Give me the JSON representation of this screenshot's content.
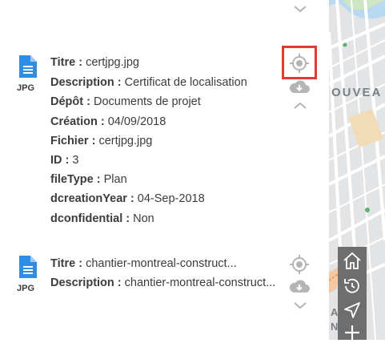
{
  "documents": [
    {
      "ext": "JPG",
      "fields": [
        {
          "key": "Titre :",
          "value": "certjpg.jpg"
        },
        {
          "key": "Description :",
          "value": "Certificat de localisation"
        },
        {
          "key": "Dépôt :",
          "value": "Documents de projet"
        },
        {
          "key": "Création :",
          "value": "04/09/2018"
        },
        {
          "key": "Fichier :",
          "value": "certjpg.jpg"
        },
        {
          "key": "ID :",
          "value": "3"
        },
        {
          "key": "fileType :",
          "value": "Plan"
        },
        {
          "key": "dcreationYear :",
          "value": "04-Sep-2018"
        },
        {
          "key": "dconfidential :",
          "value": "Non"
        }
      ]
    },
    {
      "ext": "JPG",
      "fields": [
        {
          "key": "Titre :",
          "value": "chantier-montreal-construct..."
        },
        {
          "key": "Description :",
          "value": "chantier-montreal-construct..."
        }
      ]
    }
  ],
  "map": {
    "street_label": "OUVEA",
    "partial_label_1": "A",
    "partial_label_2": "N"
  },
  "colors": {
    "doc_icon": "#2e8ee6",
    "highlight": "#e53b2c",
    "action_icon": "#b5b5b5",
    "toolbar": "#6e6e6e"
  },
  "icons": {
    "toolbar": [
      "home-icon",
      "history-icon",
      "navigate-icon",
      "add-icon"
    ]
  }
}
